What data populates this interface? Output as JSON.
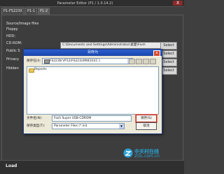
{
  "window": {
    "title": "Parameter Editor (P1 / 1.0.14.2)",
    "close_label": "X"
  },
  "tabs": [
    {
      "label": "P1-FS223X"
    },
    {
      "label": "P1-1"
    },
    {
      "label": "P1-2"
    }
  ],
  "panel": {
    "labels": [
      "Source/Image files",
      "Floppy",
      "HDD:",
      "CD-ROM:",
      "Public S",
      "Privacy",
      "Hidden"
    ],
    "cdrom_path": "C:\\Documents and Settings\\Administrator\\桌面\\Fosh",
    "select_label": "Select"
  },
  "dialog": {
    "title": "另存为",
    "close_label": "x",
    "save_in_label": "保存在(I):",
    "save_in_value": "FS223N VP12(FS223)(Mt810)[C:]",
    "folder_items": [
      "Reports"
    ],
    "filename_label": "文件名(N):",
    "filename_value": "Fosh Super USB-CDROM",
    "filetype_label": "保存类型(T):",
    "filetype_value": "Parameter Files (*.ini)",
    "save_button": "保存(S)",
    "cancel_button": "取消"
  },
  "statusbar": {
    "load_label": "Load"
  },
  "watermark": {
    "name": "中关村在线",
    "site": "ZOL.com.cn"
  }
}
